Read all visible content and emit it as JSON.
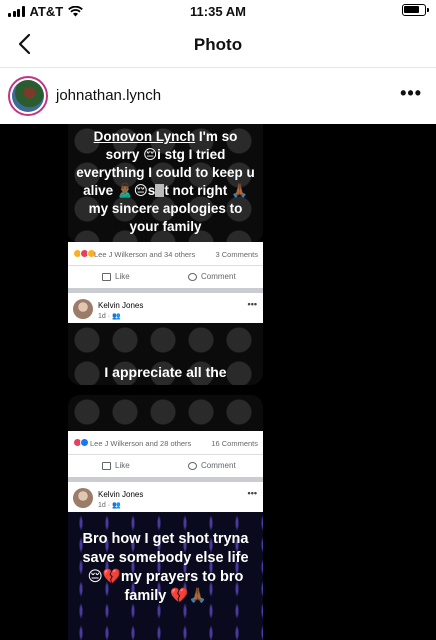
{
  "status_bar": {
    "carrier": "AT&T",
    "time": "11:35 AM",
    "battery_level": 0.8
  },
  "nav": {
    "title": "Photo"
  },
  "post": {
    "username": "johnathan.lynch"
  },
  "story1": {
    "mention": "Donovon Lynch",
    "line1": " I'm so sorry 😔i stg I tried everything I could to keep u alive 🙎🏾‍♂️😔s",
    "line2": "t not right 🙏🏾my sincere apologies to your family",
    "reactions_names": "Lee J Wilkerson and 34 others",
    "reactions_count": "3 Comments",
    "like_label": "Like",
    "comment_label": "Comment",
    "commenter": "Kelvin Jones",
    "comment_meta": "1d · 👥",
    "partial_text": "I appreciate all the"
  },
  "story2": {
    "reactions_names": "Lee J Wilkerson and 28 others",
    "reactions_count": "16 Comments",
    "like_label": "Like",
    "comment_label": "Comment",
    "commenter": "Kelvin Jones",
    "comment_meta": "1d · 👥",
    "text": "Bro how I get shot tryna save somebody else life 😔💔my prayers to bro family 💔🙏🏾"
  },
  "colors": {
    "accent": "#c13584",
    "fb_blue": "#1877f2",
    "fb_red": "#e4405f",
    "fb_yellow": "#f7b125"
  },
  "icons": {
    "back": "chevron-left-icon",
    "more": "more-horizontal-icon",
    "signal": "signal-icon",
    "wifi": "wifi-icon",
    "battery": "battery-icon"
  }
}
